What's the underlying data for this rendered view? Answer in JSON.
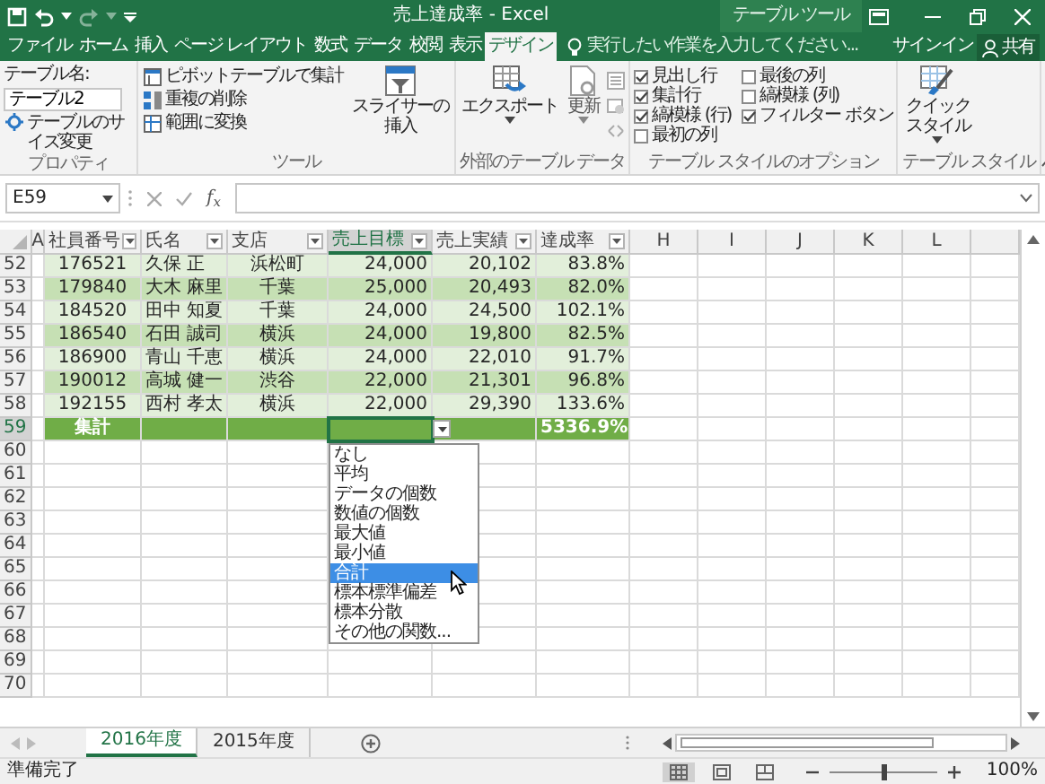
{
  "title_bar": {
    "title": "売上達成率 - Excel",
    "context_label": "テーブル ツール",
    "quick_access": [
      {
        "kind": "save",
        "disabled": false
      },
      {
        "kind": "undo",
        "disabled": false
      },
      {
        "kind": "redo",
        "disabled": true
      }
    ]
  },
  "ribbon_tabs": [
    {
      "label": "ファイル",
      "selected": false
    },
    {
      "label": "ホーム",
      "selected": false
    },
    {
      "label": "挿入",
      "selected": false
    },
    {
      "label": "ページ レイアウト",
      "selected": false
    },
    {
      "label": "数式",
      "selected": false
    },
    {
      "label": "データ",
      "selected": false
    },
    {
      "label": "校閲",
      "selected": false
    },
    {
      "label": "表示",
      "selected": false
    },
    {
      "label": "デザイン",
      "selected": true
    }
  ],
  "tell_me": {
    "placeholder": "実行したい作業を入力してください..."
  },
  "sign_in": "サインイン",
  "share": "共有",
  "ribbon_groups": [
    {
      "kind": "properties",
      "label": "プロパティ",
      "name_label": "テーブル名:",
      "name_value": "テーブル2",
      "resize": "テーブルのサイズ変更"
    },
    {
      "kind": "tools",
      "label": "ツール",
      "commands": [
        "ピボットテーブルで集計",
        "重複の削除",
        "範囲に変換"
      ],
      "slicer": "スライサーの挿入"
    },
    {
      "kind": "external",
      "label": "外部のテーブル データ",
      "export": "エクスポート",
      "refresh": "更新"
    },
    {
      "kind": "options",
      "label": "テーブル スタイルのオプション",
      "options": [
        {
          "kind": "header_row",
          "label": "見出し行",
          "checked": true
        },
        {
          "kind": "total_row",
          "label": "集計行",
          "checked": true
        },
        {
          "kind": "banded_rows",
          "label": "縞模様 (行)",
          "checked": true
        },
        {
          "kind": "first_column",
          "label": "最初の列",
          "checked": false
        },
        {
          "kind": "last_column",
          "label": "最後の列",
          "checked": false
        },
        {
          "kind": "banded_columns",
          "label": "縞模様 (列)",
          "checked": false
        },
        {
          "kind": "filter_button",
          "label": "フィルター ボタン",
          "checked": true
        }
      ]
    },
    {
      "kind": "styles",
      "label": "テーブル スタイル",
      "quick_styles": "クイックスタイル"
    }
  ],
  "formula_bar": {
    "name_box": "E59",
    "insert_function": "f$_{x}$"
  },
  "columns": [
    {
      "label": "A",
      "kind": "letter",
      "selected": false
    },
    {
      "label": "社員番号",
      "kind": "table",
      "selected": false
    },
    {
      "label": "氏名",
      "kind": "table",
      "selected": false
    },
    {
      "label": "支店",
      "kind": "table",
      "selected": false
    },
    {
      "label": "売上目標",
      "kind": "table",
      "selected": true
    },
    {
      "label": "売上実績",
      "kind": "table",
      "selected": false
    },
    {
      "label": "達成率",
      "kind": "table",
      "selected": false
    },
    {
      "label": "H",
      "kind": "letter",
      "selected": false
    },
    {
      "label": "I",
      "kind": "letter",
      "selected": false
    },
    {
      "label": "J",
      "kind": "letter",
      "selected": false
    },
    {
      "label": "K",
      "kind": "letter",
      "selected": false
    },
    {
      "label": "L",
      "kind": "letter",
      "selected": false
    }
  ],
  "rows": [
    {
      "number": "52",
      "kind": "data",
      "selected": false,
      "cells": [
        "176521",
        "久保 正",
        "浜松町",
        "24,000",
        "20,102",
        "83.8%"
      ]
    },
    {
      "number": "53",
      "kind": "data",
      "selected": false,
      "cells": [
        "179840",
        "大木 麻里",
        "千葉",
        "25,000",
        "20,493",
        "82.0%"
      ]
    },
    {
      "number": "54",
      "kind": "data",
      "selected": false,
      "cells": [
        "184520",
        "田中 知夏",
        "千葉",
        "24,000",
        "24,500",
        "102.1%"
      ]
    },
    {
      "number": "55",
      "kind": "data",
      "selected": false,
      "cells": [
        "186540",
        "石田 誠司",
        "横浜",
        "24,000",
        "19,800",
        "82.5%"
      ]
    },
    {
      "number": "56",
      "kind": "data",
      "selected": false,
      "cells": [
        "186900",
        "青山 千恵",
        "横浜",
        "24,000",
        "22,010",
        "91.7%"
      ]
    },
    {
      "number": "57",
      "kind": "data",
      "selected": false,
      "cells": [
        "190012",
        "高城 健一",
        "渋谷",
        "22,000",
        "21,301",
        "96.8%"
      ]
    },
    {
      "number": "58",
      "kind": "data",
      "selected": false,
      "cells": [
        "192155",
        "西村 孝太",
        "横浜",
        "22,000",
        "29,390",
        "133.6%"
      ]
    },
    {
      "number": "59",
      "kind": "total",
      "selected": true,
      "label": "集計",
      "rate": "5336.9%",
      "dropdown": [
        {
          "label": "なし",
          "selected": false
        },
        {
          "label": "平均",
          "selected": false
        },
        {
          "label": "データの個数",
          "selected": false
        },
        {
          "label": "数値の個数",
          "selected": false
        },
        {
          "label": "最大値",
          "selected": false
        },
        {
          "label": "最小値",
          "selected": false
        },
        {
          "label": "合計",
          "selected": true
        },
        {
          "label": "標本標準偏差",
          "selected": false
        },
        {
          "label": "標本分散",
          "selected": false
        },
        {
          "label": "その他の関数...",
          "selected": false
        }
      ]
    },
    {
      "number": "60",
      "kind": "empty",
      "selected": false
    },
    {
      "number": "61",
      "kind": "empty",
      "selected": false
    },
    {
      "number": "62",
      "kind": "empty",
      "selected": false
    },
    {
      "number": "63",
      "kind": "empty",
      "selected": false
    },
    {
      "number": "64",
      "kind": "empty",
      "selected": false
    },
    {
      "number": "65",
      "kind": "empty",
      "selected": false
    },
    {
      "number": "66",
      "kind": "empty",
      "selected": false
    },
    {
      "number": "67",
      "kind": "empty",
      "selected": false
    },
    {
      "number": "68",
      "kind": "empty",
      "selected": false
    },
    {
      "number": "69",
      "kind": "empty",
      "selected": false
    },
    {
      "number": "70",
      "kind": "empty",
      "selected": false
    }
  ],
  "sheet_tabs": [
    {
      "label": "2016年度",
      "selected": true
    },
    {
      "label": "2015年度",
      "selected": false
    }
  ],
  "status_bar": {
    "text": "準備完了",
    "views": [
      {
        "kind": "normal",
        "selected": true
      },
      {
        "kind": "page_layout",
        "selected": false
      },
      {
        "kind": "page_break",
        "selected": false
      }
    ],
    "zoom": {
      "level": 0.5,
      "reading": "100%"
    }
  }
}
